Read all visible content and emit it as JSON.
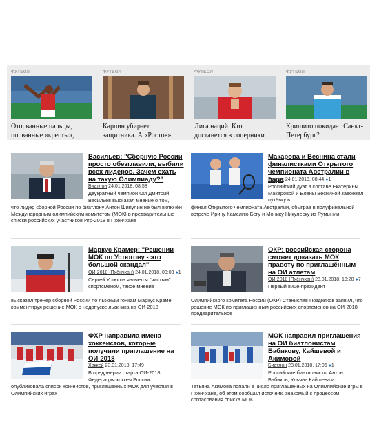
{
  "strip": {
    "cards": [
      {
        "category": "ФУТБОЛ",
        "title": "Оторванные пальцы, порванные «кресты»,"
      },
      {
        "category": "ФУТБОЛ",
        "title": "Карпин убирает защитника. А «Ростов»"
      },
      {
        "category": "ФУТБОЛ",
        "title": "Лига наций. Кто достанется в соперники"
      },
      {
        "category": "ФУТБОЛ",
        "title": "Кришито покидает Санкт-Петербург?"
      }
    ]
  },
  "news": [
    {
      "headline": "Васильев: \"Сборную России просто обезглавили, выбили всех лидеров. Зачем ехать на такую Олимпиаду?\"",
      "tag": "Биатлон",
      "date": "24.01.2018, 08:58",
      "comments": "",
      "lead_side": "Двукратный чемпион ОИ Дмитрий Васильев высказал мнение о том,",
      "lead_full": "что лидер сборной России по биатлону Антон Шипулин не был включён Международным олимпийским комитетом (МОК) в предварительные списки российских участников Игр-2018 в Пхёнчхане"
    },
    {
      "headline": "Макарова и Веснина стали финалистками Открытого чемпионата Австралии в паре",
      "tag": "Теннис",
      "date": "24.01.2018, 08:44",
      "comments": "1",
      "lead_side": "Российский дуэт в составе Екатерины Макаровой и Елены Весниной завоевал путёвку в",
      "lead_full": "финал Открытого чемпионата Австралии, обыграв в полуфинальной встрече Ирину Камелию Бегу и Монику Никулеску из Румынии"
    },
    {
      "headline": "Маркус Крамер: \"Решении МОК по Устюгову - это большой скандал\"",
      "tag": "ОИ-2018 (Пхёнчхан)",
      "date": "24.01.2018, 00:03",
      "comments": "1",
      "lead_side": "Сергей Устюгов является \"чистым\" спортсменом, такое мнение",
      "lead_full": "высказал тренер сборной России по лыжным гонкам Маркус Краме, комментируя решение МОК о недопуске лыжника на ОИ-2018"
    },
    {
      "headline": "ОКР: российская сторона сможет доказать МОК правоту по приглашённым на ОИ атлетам",
      "tag": "ОИ-2018 (Пхёнчхан)",
      "date": "23.01.2018, 18:20",
      "comments": "7",
      "lead_side": "Первый вице-президент",
      "lead_full": "Олимпийского комитета России (ОКР) Станислав Поздняков заявил, что решение МОК по приглашенным российских спортсменов на ОИ-2018 предварительное"
    },
    {
      "headline": "ФХР направила имена хоккеистов, которые получили приглашение на ОИ-2018",
      "tag": "Хоккей",
      "date": "23.01.2018, 17:49",
      "comments": "",
      "lead_side": "В преддверии старта ОИ-2018 Федерация хоккея России",
      "lead_full": "опубликовала список хоккеистов, приглашённых МОК для участия в Олимпийских играх"
    },
    {
      "headline": "МОК направил приглашения на ОИ биатлонистам Бабикову, Кайшевой и Акимовой",
      "tag": "Биатлон",
      "date": "23.01.2018, 17:06",
      "comments": "1",
      "lead_side": "Российские биатлонисты Антон Бабиков, Ульяна Кайшева и",
      "lead_full": "Татьяна Акимова попали в число приглашенных на Олимпийские игры в Пхёнчхане, об этом сообщил источник, знакомый с процессом согласования списка МОК"
    }
  ]
}
